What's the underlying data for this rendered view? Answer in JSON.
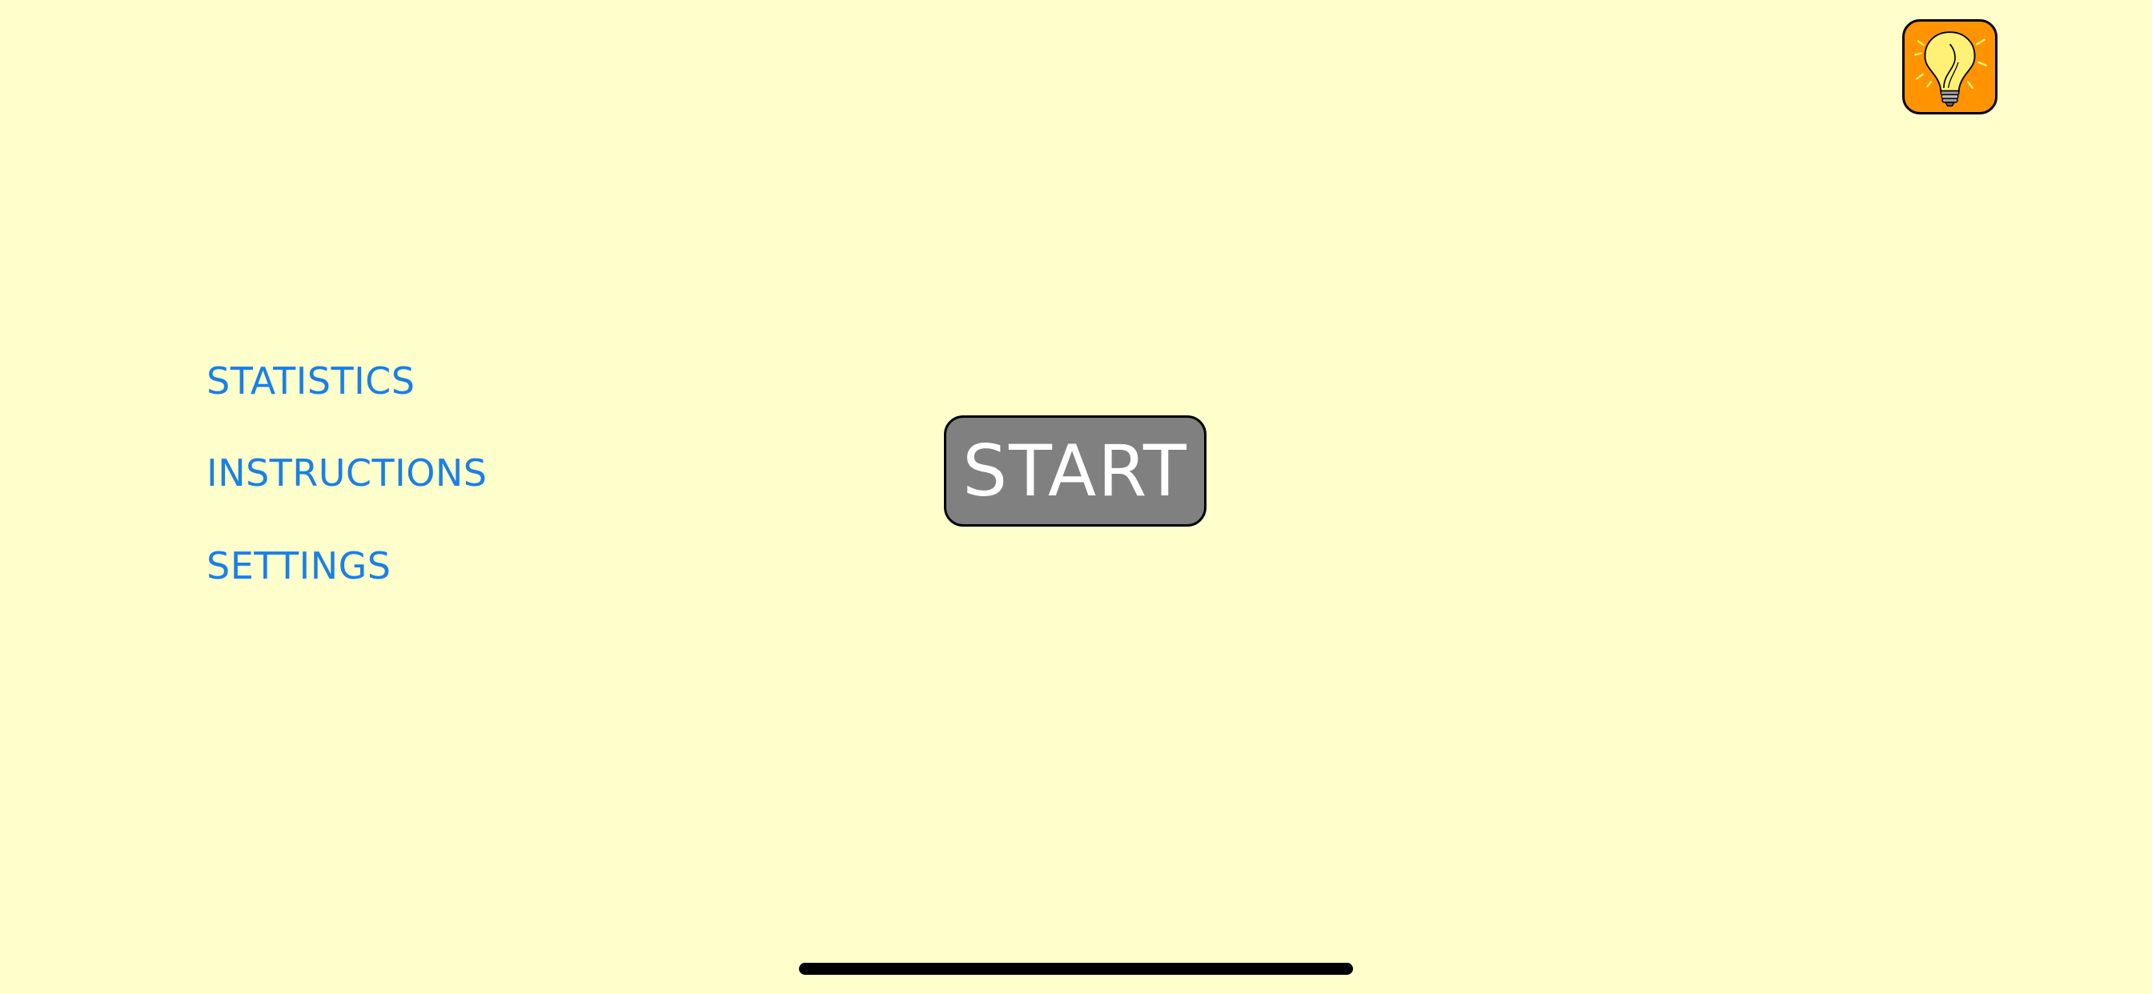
{
  "menu": {
    "items": [
      {
        "id": "statistics",
        "label": "STATISTICS"
      },
      {
        "id": "instructions",
        "label": "INSTRUCTIONS"
      },
      {
        "id": "settings",
        "label": "SETTINGS"
      }
    ]
  },
  "start_button": {
    "label": "START"
  },
  "hint_button": {
    "icon": "lightbulb-icon"
  },
  "colors": {
    "background": "#ffffcc",
    "link": "#1a7fe6",
    "start_button": "#808080",
    "hint_button": "#ff9400",
    "bulb": "#fff176"
  }
}
